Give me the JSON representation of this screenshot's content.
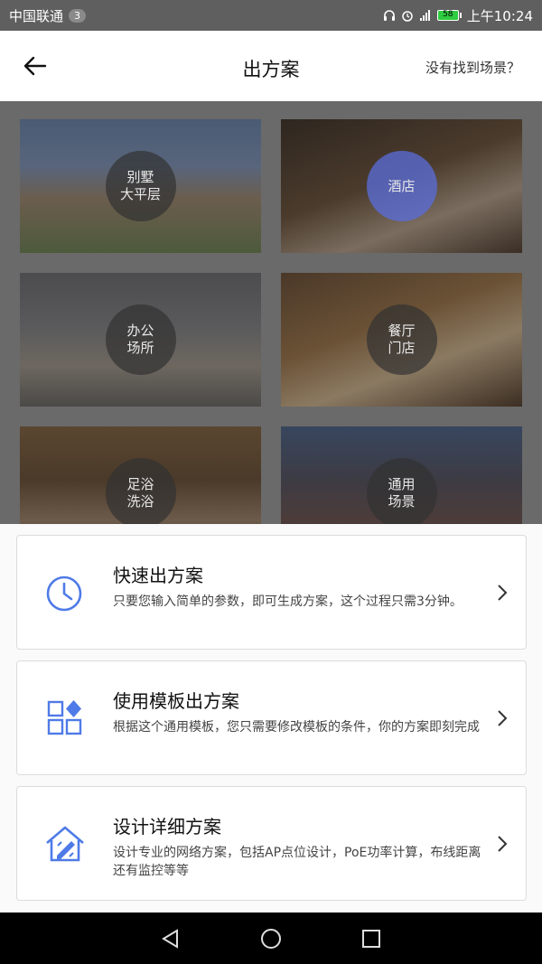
{
  "status_bar": {
    "carrier": "中国联通",
    "sim_badge": "3",
    "battery": "58",
    "time": "上午10:24"
  },
  "header": {
    "title": "出方案",
    "right_link": "没有找到场景？"
  },
  "scenes": [
    {
      "label": "别墅\n大平层"
    },
    {
      "label": "酒店"
    },
    {
      "label": "办公\n场所"
    },
    {
      "label": "餐厅\n门店"
    },
    {
      "label": "足浴\n洗浴"
    },
    {
      "label": "通用\n场景"
    }
  ],
  "options": [
    {
      "title": "快速出方案",
      "desc": "只要您输入简单的参数，即可生成方案，这个过程只需3分钟。",
      "icon": "clock-icon"
    },
    {
      "title": "使用模板出方案",
      "desc": "根据这个通用模板，您只需要修改模板的条件，你的方案即刻完成",
      "icon": "template-grid-icon"
    },
    {
      "title": "设计详细方案",
      "desc": "设计专业的网络方案，包括AP点位设计，PoE功率计算，布线距离还有监控等等",
      "icon": "house-design-icon"
    }
  ],
  "colors": {
    "accent": "#4f7be8",
    "active_scene": "#5a6edc"
  }
}
